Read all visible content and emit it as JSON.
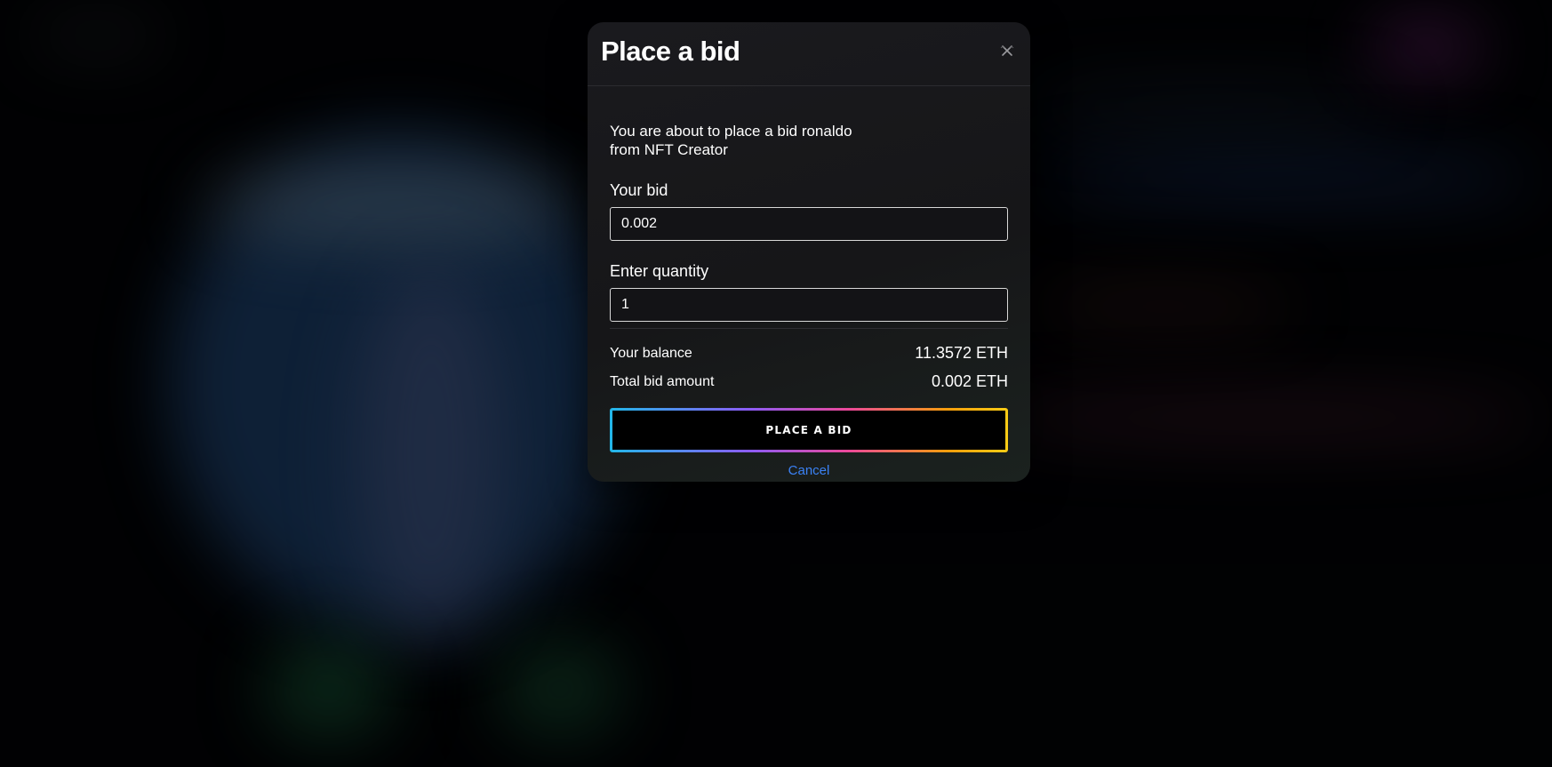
{
  "modal": {
    "title": "Place a bid",
    "close_icon": "close-icon",
    "intro_line1": "You are about to place a bid ronaldo",
    "intro_line2": "from NFT Creator",
    "bid": {
      "label": "Your bid",
      "value": "0.002"
    },
    "quantity": {
      "label": "Enter quantity",
      "value": "1"
    },
    "summary": {
      "balance_label": "Your balance",
      "balance_value": "11.3572 ETH",
      "total_label": "Total bid amount",
      "total_value": "0.002 ETH"
    },
    "place_button_label": "PLACE A BID",
    "cancel_label": "Cancel"
  },
  "colors": {
    "accent_link": "#3b82f6",
    "button_gradient": [
      "#22b7e8",
      "#8b5cf6",
      "#ec4899",
      "#f59e0b",
      "#facc15"
    ],
    "modal_bg": "#1a1a1e"
  }
}
